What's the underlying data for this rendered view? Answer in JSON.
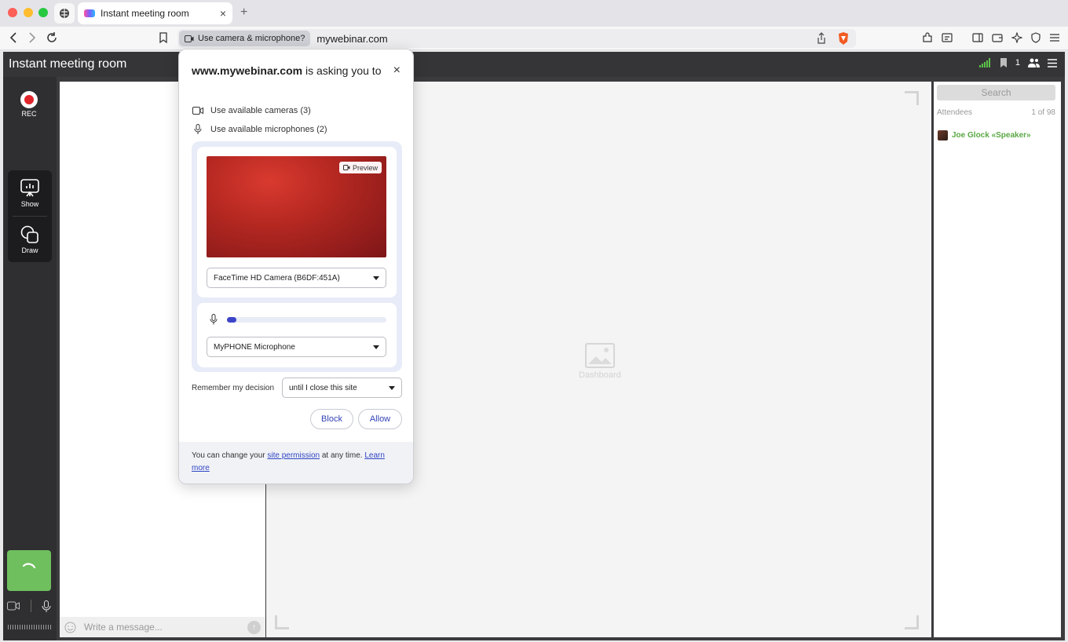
{
  "browser": {
    "tab_title": "Instant meeting room",
    "tab_close": "×",
    "new_tab": "+",
    "permission_chip": "Use camera & microphone?",
    "url": "mywebinar.com"
  },
  "app": {
    "title": "Instant meeting room",
    "participant_count": "1",
    "rec_label": "REC",
    "tools": {
      "show_label": "Show",
      "draw_label": "Draw"
    },
    "chat": {
      "placeholder": "Write a message..."
    },
    "dashboard": {
      "label": "Dashboard"
    },
    "attendees": {
      "search": "Search",
      "label": "Attendees",
      "count": "1 of 98",
      "list": [
        {
          "name": "Joe Glock «Speaker»"
        }
      ]
    }
  },
  "popup": {
    "site": "www.mywebinar.com",
    "title_rest": " is asking you to",
    "close": "×",
    "camera_line": "Use available cameras (3)",
    "mic_line": "Use available microphones (2)",
    "preview_badge": "Preview",
    "camera_select": "FaceTime HD Camera (B6DF:451A)",
    "mic_level": 0.06,
    "mic_select": "MyPHONE Microphone",
    "remember_label": "Remember my decision",
    "remember_select": "until I close this site",
    "block": "Block",
    "allow": "Allow",
    "footer_text_1": "You can change your ",
    "footer_link_1": "site permission",
    "footer_text_2": " at any time. ",
    "footer_link_2": "Learn more"
  },
  "colors": {
    "accent": "#3d44c8",
    "speaker_green": "#5aa845",
    "rec_red": "#e0262b",
    "tile_green": "#6fbf5e"
  }
}
